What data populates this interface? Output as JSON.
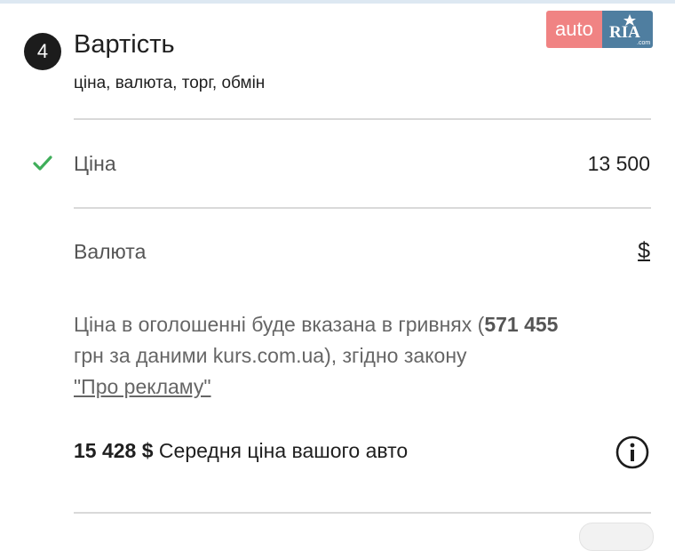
{
  "section": {
    "step_number": "4",
    "title": "Вартість",
    "subtitle": "ціна, валюта, торг, обмін"
  },
  "logo": {
    "auto_text": "auto",
    "ria_text": "RIA",
    "ria_suffix": ".com"
  },
  "price": {
    "label": "Ціна",
    "value": "13 500",
    "status_icon": "check-icon"
  },
  "currency": {
    "label": "Валюта",
    "value": "$"
  },
  "notice": {
    "text_before": "Ціна в оголошенні буде вказана в гривнях (",
    "amount": "571 455",
    "text_after": "грн за даними kurs.com.ua), згідно закону",
    "link_text": "\"Про рекламу\""
  },
  "average": {
    "amount": "15 428 $",
    "text": " Середня ціна вашого авто",
    "icon": "info-icon"
  },
  "colors": {
    "check": "#3fae5a",
    "logo_auto": "#f08383",
    "logo_ria": "#4f7ea0"
  }
}
